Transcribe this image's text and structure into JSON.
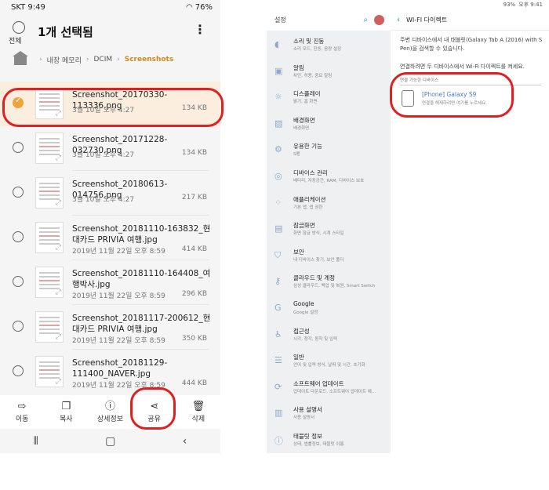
{
  "phone": {
    "status": {
      "carrier_time": "SKT 9:49",
      "battery": "76%"
    },
    "header": {
      "select_all": "전체",
      "title": "1개 선택됨",
      "more_icon": "⋮"
    },
    "breadcrumb": [
      "내장 메모리",
      "DCIM",
      "Screenshots"
    ],
    "files": [
      {
        "name": "Screenshot_20170330-113336.png",
        "date": "3월 10일 오후 4:27",
        "size": "134 KB",
        "selected": true
      },
      {
        "name": "Screenshot_20171228-032730.png",
        "date": "3월 10일 오후 4:27",
        "size": "134 KB",
        "selected": false
      },
      {
        "name": "Screenshot_20180613-014756.png",
        "date": "3월 10일 오후 4:27",
        "size": "217 KB",
        "selected": false
      },
      {
        "name": "Screenshot_20181110-163832_현대카드 PRIVIA 여행.jpg",
        "date": "2019년 11월 22일 오후 8:59",
        "size": "414 KB",
        "selected": false
      },
      {
        "name": "Screenshot_20181110-164408_여행박사.jpg",
        "date": "2019년 11월 22일 오후 8:59",
        "size": "296 KB",
        "selected": false
      },
      {
        "name": "Screenshot_20181117-200612_현대카드 PRIVIA 여행.jpg",
        "date": "2019년 11월 22일 오후 8:59",
        "size": "350 KB",
        "selected": false
      },
      {
        "name": "Screenshot_20181129-111400_NAVER.jpg",
        "date": "2019년 11월 22일 오후 8:59",
        "size": "444 KB",
        "selected": false
      }
    ],
    "actions": [
      {
        "icon": "move-icon",
        "label": "이동"
      },
      {
        "icon": "copy-icon",
        "label": "복사"
      },
      {
        "icon": "info-icon",
        "label": "상세정보"
      },
      {
        "icon": "share-icon",
        "label": "공유"
      },
      {
        "icon": "delete-icon",
        "label": "삭제"
      }
    ]
  },
  "tablet": {
    "status": {
      "battery": "93%",
      "time": "오후 9:41"
    },
    "sidebar": {
      "title": "설정",
      "items": [
        {
          "icon": "sound-icon",
          "label": "소리 및 진동",
          "sub": "소리 모드, 진동, 음량 설정"
        },
        {
          "icon": "notification-icon",
          "label": "알림",
          "sub": "차단, 허용, 중요 알림"
        },
        {
          "icon": "display-icon",
          "label": "디스플레이",
          "sub": "밝기, 홈 화면"
        },
        {
          "icon": "wallpaper-icon",
          "label": "배경화면",
          "sub": "배경화면"
        },
        {
          "icon": "advanced-icon",
          "label": "유용한 기능",
          "sub": "S펜"
        },
        {
          "icon": "device-care-icon",
          "label": "디바이스 관리",
          "sub": "배터리, 저장공간, RAM, 디바이스 보호"
        },
        {
          "icon": "apps-icon",
          "label": "애플리케이션",
          "sub": "기본 앱, 앱 권한"
        },
        {
          "icon": "lock-icon",
          "label": "잠금화면",
          "sub": "화면 잠금 방식, 시계 스타일"
        },
        {
          "icon": "security-icon",
          "label": "보안",
          "sub": "내 디바이스 찾기, 보안 폴더"
        },
        {
          "icon": "cloud-icon",
          "label": "클라우드 및 계정",
          "sub": "삼성 클라우드, 백업 및 복원, Smart Switch"
        },
        {
          "icon": "google-icon",
          "label": "Google",
          "sub": "Google 설정"
        },
        {
          "icon": "accessibility-icon",
          "label": "접근성",
          "sub": "시각, 청각, 동작 및 입력"
        },
        {
          "icon": "general-icon",
          "label": "일반",
          "sub": "언어 및 입력 방식, 날짜 및 시간, 초기화"
        },
        {
          "icon": "update-icon",
          "label": "소프트웨어 업데이트",
          "sub": "업데이트 다운로드, 소프트웨어 업데이트 예..."
        },
        {
          "icon": "manual-icon",
          "label": "사용 설명서",
          "sub": "사용 설명서"
        },
        {
          "icon": "about-icon",
          "label": "태블릿 정보",
          "sub": "상태, 법률정보, 태블릿 이름"
        }
      ]
    },
    "main": {
      "title": "WI-FI 다이렉트",
      "description": "주변 디바이스에서 내 태블릿(Galaxy Tab A (2016) with S Pen)을 검색할 수 있습니다.",
      "instruction": "연결하려면 두 디바이스에서 Wi-Fi 다이렉트를 켜세요.",
      "section": "연결 가능한 디바이스",
      "device": {
        "name": "[Phone] Galaxy S9",
        "sub": "연결을 해제하려면 여기를 누르세요."
      }
    }
  },
  "colors": {
    "accent": "#f0a33a",
    "highlight": "#e02020",
    "link": "#4a7cc4"
  }
}
